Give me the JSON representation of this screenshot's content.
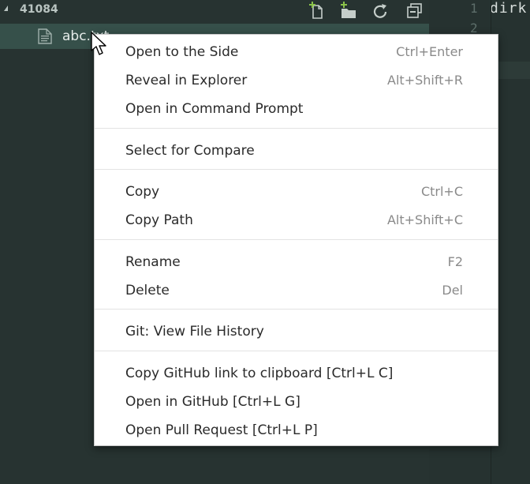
{
  "explorer": {
    "folder_name": "41084",
    "file_name": "abc.txt",
    "toolbar": {
      "new_file_icon": "new-file-icon",
      "new_folder_icon": "new-folder-icon",
      "refresh_icon": "refresh-icon",
      "collapse_icon": "collapse-all-icon"
    }
  },
  "editor": {
    "line_numbers": [
      "1",
      "2"
    ],
    "code_text": "dirk"
  },
  "context_menu": {
    "items": [
      {
        "label": "Open to the Side",
        "shortcut": "Ctrl+Enter"
      },
      {
        "label": "Reveal in Explorer",
        "shortcut": "Alt+Shift+R"
      },
      {
        "label": "Open in Command Prompt",
        "shortcut": ""
      },
      {
        "label": "Select for Compare",
        "shortcut": ""
      },
      {
        "label": "Copy",
        "shortcut": "Ctrl+C"
      },
      {
        "label": "Copy Path",
        "shortcut": "Alt+Shift+C"
      },
      {
        "label": "Rename",
        "shortcut": "F2"
      },
      {
        "label": "Delete",
        "shortcut": "Del"
      },
      {
        "label": "Git: View File History",
        "shortcut": ""
      },
      {
        "label": "Copy GitHub link to clipboard [Ctrl+L C]",
        "shortcut": ""
      },
      {
        "label": "Open in GitHub [Ctrl+L G]",
        "shortcut": ""
      },
      {
        "label": "Open Pull Request [Ctrl+L P]",
        "shortcut": ""
      }
    ]
  },
  "colors": {
    "sidebar_bg": "#273331",
    "selected_row": "#36504a",
    "menu_bg": "#ffffff",
    "shortcut_text": "#8a8a8a"
  }
}
